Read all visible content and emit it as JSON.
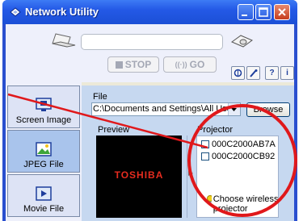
{
  "window": {
    "title": "Network Utility"
  },
  "toolbar": {
    "stop_label": "STOP",
    "go_label": "GO",
    "go_icon_text": "((·))"
  },
  "small_buttons": [
    "network-icon",
    "tools-icon",
    "?",
    "i"
  ],
  "tabs": [
    {
      "label": "Screen Image",
      "icon": "screen-image-icon"
    },
    {
      "label": "JPEG File",
      "icon": "jpeg-file-icon",
      "active": true
    },
    {
      "label": "Movie File",
      "icon": "movie-file-icon"
    }
  ],
  "file": {
    "label": "File",
    "path": "C:\\Documents and Settings\\All Users\\[",
    "browse_label": "Browse"
  },
  "preview": {
    "label": "Preview",
    "brand_text": "TOSHIBA"
  },
  "projector": {
    "label": "Projector",
    "items": [
      {
        "name": "000C2000AB7A",
        "checked": false
      },
      {
        "name": "000C2000CB92",
        "checked": false
      }
    ],
    "hint": "Choose wireless projector"
  },
  "colors": {
    "title_bar": "#2459e6",
    "highlight": "#e0181b",
    "brand": "#e52c1f"
  }
}
